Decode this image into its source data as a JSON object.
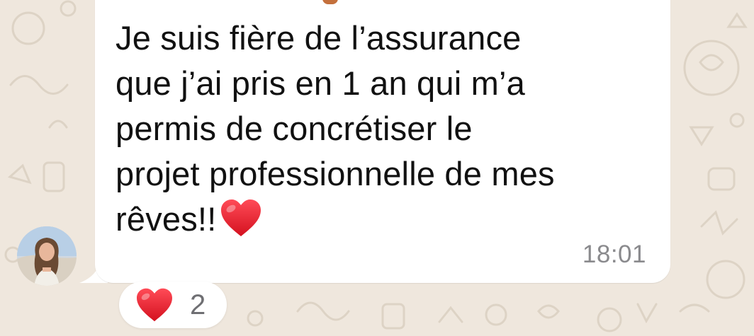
{
  "message": {
    "lines": [
      "Je suis fière de l’assurance",
      "que j’ai pris en 1 an qui m’a",
      "permis de concrétiser le",
      "projet professionnelle de mes",
      "rêves!!"
    ],
    "emoji": "heart-emoji",
    "timestamp": "18:01"
  },
  "reaction": {
    "emoji": "heart-emoji",
    "count": "2"
  },
  "colors": {
    "background": "#efe7dd",
    "bubble": "#ffffff",
    "heart": "#e0192d",
    "timestamp": "#8a8a8d"
  }
}
